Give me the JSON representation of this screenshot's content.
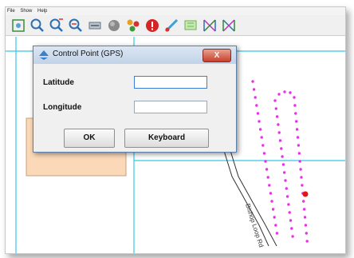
{
  "menu": [
    "File",
    "Show",
    "Help"
  ],
  "toolbar_icons": [
    "zoom-extents-icon",
    "zoom-in-icon",
    "zoom-in-plus-icon",
    "zoom-out-icon",
    "pan-icon",
    "record-icon",
    "waypoints-icon",
    "alert-icon",
    "measure-icon",
    "flag-icon",
    "grid-icon",
    "grid-alt-icon"
  ],
  "map": {
    "road_label": "Bishop Loop Rd",
    "colors": {
      "grid": "#35c7e6",
      "points": "#e832e8",
      "current": "#e01818",
      "parcel": "#fbd9b8"
    }
  },
  "dialog": {
    "title": "Control Point (GPS)",
    "close_label": "X",
    "latitude_label": "Latitude",
    "latitude_value": "",
    "longitude_label": "Longitude",
    "longitude_value": "",
    "ok_label": "OK",
    "keyboard_label": "Keyboard"
  }
}
